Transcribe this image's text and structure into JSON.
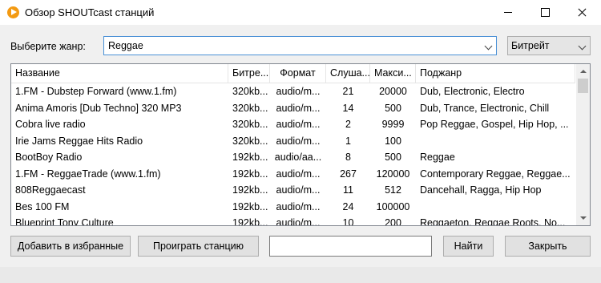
{
  "window": {
    "title": "Обзор SHOUTcast станций",
    "icon": "shoutcast-play-icon",
    "accent_color": "#f39a12"
  },
  "filter": {
    "genre_label": "Выберите жанр:",
    "genre_value": "Reggae",
    "sort_value": "Битрейт"
  },
  "table": {
    "columns": [
      "Название",
      "Битре...",
      "Формат",
      "Слуша...",
      "Макси...",
      "Поджанр"
    ],
    "rows": [
      [
        "1.FM - Dubstep Forward (www.1.fm)",
        "320kb...",
        "audio/m...",
        "21",
        "20000",
        "Dub, Electronic, Electro"
      ],
      [
        "Anima Amoris [Dub Techno] 320 MP3",
        "320kb...",
        "audio/m...",
        "14",
        "500",
        "Dub, Trance, Electronic, Chill"
      ],
      [
        "Cobra live radio",
        "320kb...",
        "audio/m...",
        "2",
        "9999",
        "Pop Reggae, Gospel, Hip Hop, ..."
      ],
      [
        "Irie Jams Reggae Hits Radio",
        "320kb...",
        "audio/m...",
        "1",
        "100",
        ""
      ],
      [
        "BootBoy Radio",
        "192kb...",
        "audio/aa...",
        "8",
        "500",
        "Reggae"
      ],
      [
        "1.FM - ReggaeTrade (www.1.fm)",
        "192kb...",
        "audio/m...",
        "267",
        "120000",
        "Contemporary Reggae, Reggae..."
      ],
      [
        "808Reggaecast",
        "192kb...",
        "audio/m...",
        "11",
        "512",
        "Dancehall, Ragga, Hip Hop"
      ],
      [
        "Bes 100 FM",
        "192kb...",
        "audio/m...",
        "24",
        "100000",
        ""
      ],
      [
        "Blueprint Tony Culture",
        "192kb...",
        "audio/m...",
        "10",
        "200",
        "Reggaeton, Reggae Roots, No..."
      ]
    ]
  },
  "buttons": {
    "add_favorites": "Добавить в избранные",
    "play_station": "Проиграть станцию",
    "find": "Найти",
    "close": "Закрыть"
  },
  "search": {
    "value": ""
  }
}
